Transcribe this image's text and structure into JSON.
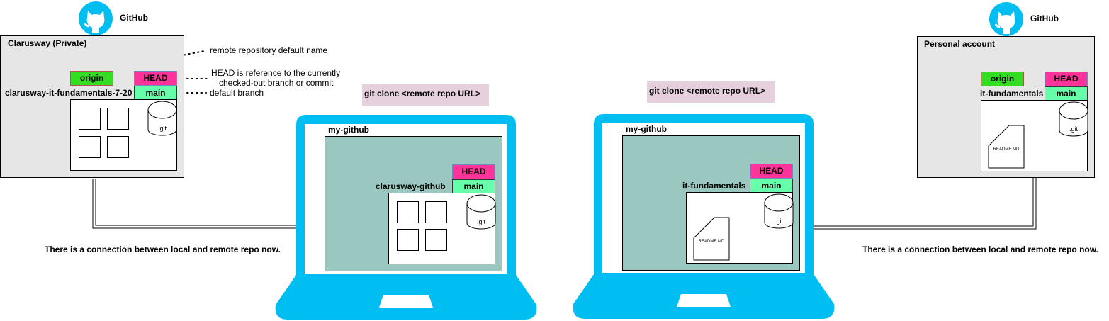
{
  "colors": {
    "laptop": "#00bef2",
    "origin_tag": "#33dd22",
    "head_tag": "#ff3399",
    "main_tag": "#66ffaa",
    "screen": "#9ac7bf",
    "command_bg": "#e6d0de",
    "panel_bg": "#e6e6e6"
  },
  "left_remote": {
    "github_label": "GitHub",
    "title": "Clarusway (Private)",
    "origin_tag": "origin",
    "head_tag": "HEAD",
    "main_tag": "main",
    "repo_name": "clarusway-it-fundamentals-7-20",
    "git_label": ".git",
    "icon": "github-octocat-icon"
  },
  "annotations": {
    "remote_default_name": "remote repository default name",
    "head_reference_line1": "HEAD is reference to the currently",
    "head_reference_line2": "checked-out branch or commit",
    "default_branch": "default branch"
  },
  "left_laptop": {
    "command": "git clone <remote repo URL>",
    "folder": "my-github",
    "head_tag": "HEAD",
    "main_tag": "main",
    "repo_name": "clarusway-github",
    "git_label": ".git",
    "connection_note": "There is a connection between local and remote repo now."
  },
  "right_laptop": {
    "command": "git clone <remote repo URL>",
    "folder": "my-github",
    "head_tag": "HEAD",
    "main_tag": "main",
    "repo_name": "it-fundamentals",
    "git_label": ".git",
    "file_label": "README.MD"
  },
  "right_remote": {
    "github_label": "GitHub",
    "title": "Personal account",
    "origin_tag": "origin",
    "head_tag": "HEAD",
    "main_tag": "main",
    "repo_name": "it-fundamentals",
    "git_label": ".git",
    "file_label": "README.MD",
    "connection_note": "There is a connection between local and remote repo now.",
    "icon": "github-octocat-icon"
  }
}
